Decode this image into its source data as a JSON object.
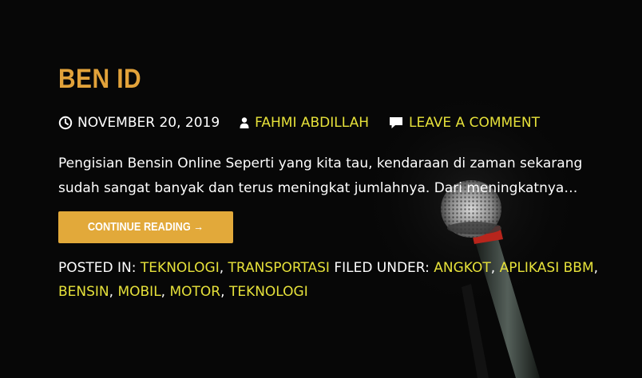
{
  "colors": {
    "background": "#070707",
    "title": "#e2a23a",
    "link": "#e6e13a",
    "button": "#e2a93a"
  },
  "post": {
    "title": "BEN ID",
    "date": "NOVEMBER 20, 2019",
    "author": "FAHMI ABDILLAH",
    "comment_link": "LEAVE A COMMENT",
    "excerpt": "Pengisian Bensin Online Seperti yang kita tau, kendaraan di zaman sekarang sudah sangat banyak dan terus meningkat jumlahnya. Dari meningkatnya…",
    "read_more": "CONTINUE READING →",
    "posted_in_label": "POSTED IN:",
    "categories": [
      "TEKNOLOGI",
      "TRANSPORTASI"
    ],
    "filed_under_label": "FILED UNDER:",
    "tags": [
      "ANGKOT",
      "APLIKASI BBM",
      "BENSIN",
      "MOBIL",
      "MOTOR",
      "TEKNOLOGI"
    ]
  },
  "icons": {
    "date": "clock-icon",
    "author": "user-icon",
    "comment": "comment-icon"
  }
}
